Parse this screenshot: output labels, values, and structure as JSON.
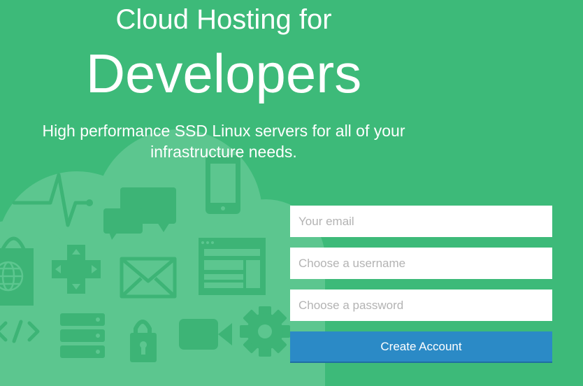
{
  "hero": {
    "title_line1": "Cloud Hosting for",
    "title_line2": "Developers",
    "subtitle_line1": "High performance SSD Linux servers for all of your",
    "subtitle_line2": "infrastructure needs."
  },
  "illustration": {
    "icons": [
      "cloud-icon",
      "heartbeat-icon",
      "chat-bubbles-icon",
      "phone-icon",
      "shopping-bag-icon",
      "globe-icon",
      "dpad-icon",
      "envelope-icon",
      "browser-window-icon",
      "code-icon",
      "server-stack-icon",
      "padlock-icon",
      "video-camera-icon",
      "gear-icon"
    ]
  },
  "signup": {
    "email_placeholder": "Your email",
    "username_placeholder": "Choose a username",
    "password_placeholder": "Choose a password",
    "submit_label": "Create Account"
  },
  "colors": {
    "background": "#3dba79",
    "cloud": "#5cc68f",
    "icon": "#3db476",
    "button": "#2b8ac6"
  }
}
